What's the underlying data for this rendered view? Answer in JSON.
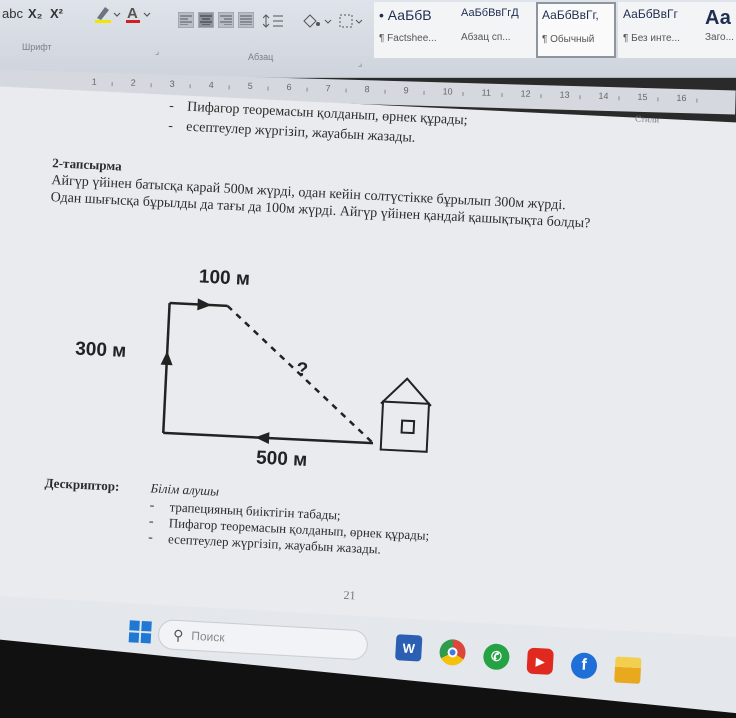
{
  "ribbon": {
    "font_group_label": "Шрифт",
    "paragraph_group_label": "Абзац",
    "styles_group_label": "Стили",
    "font_buttons": [
      "abc",
      "X₂",
      "X²"
    ],
    "styles": [
      {
        "sample": "• АаБбВ",
        "name": "¶ Factshee..."
      },
      {
        "sample": "АаБбВвГгД",
        "name": "Абзац сп..."
      },
      {
        "sample": "АаБбВвГг,",
        "name": "¶ Обычный"
      },
      {
        "sample": "АаБбВвГг",
        "name": "¶ Без инте..."
      },
      {
        "sample": "Аа",
        "name": "Заго..."
      }
    ],
    "accent_highlight": "#f2e600",
    "accent_font_color": "#d22020"
  },
  "ruler": {
    "numbers": [
      "1",
      "2",
      "3",
      "4",
      "5",
      "6",
      "7",
      "8",
      "9",
      "10",
      "11",
      "12",
      "13",
      "14",
      "15",
      "16"
    ]
  },
  "document": {
    "top_bullets": [
      "Пифагор теоремасын қолданып, өрнек құрады;",
      "есептеулер жүргізіп, жауабын жазады."
    ],
    "task_title": "2-тапсырма",
    "task_lines": [
      "Айгүр үйінен батысқа қарай 500м жүрді, одан кейін солтүстікке бұрылып 300м жүрді.",
      "Одан шығысқа бұрылды да тағы да 100м жүрді. Айгүр үйінен қандай қашықтықта болды?"
    ],
    "diagram": {
      "label_top": "100 м",
      "label_left": "300 м",
      "label_bottom": "500 м",
      "label_question": "?"
    },
    "descriptor_label": "Дескриптор:",
    "descriptor_head": "Білім алушы",
    "descriptor_bullets": [
      "трапецияның биіктігін табады;",
      "Пифагор теоремасын қолданып, өрнек құрады;",
      "есептеулер жүргізіп, жауабын жазады."
    ],
    "page_number": "21"
  },
  "taskbar": {
    "search_placeholder": "Поиск",
    "icons": [
      {
        "name": "word",
        "glyph": "W",
        "color": "#2b5fb4"
      },
      {
        "name": "chrome",
        "glyph": "",
        "color": "#d9483b"
      },
      {
        "name": "whatsapp",
        "glyph": "✆",
        "color": "#25a244"
      },
      {
        "name": "youtube",
        "glyph": "▶",
        "color": "#e02a20"
      },
      {
        "name": "facebook",
        "glyph": "f",
        "color": "#1f6fd9"
      },
      {
        "name": "file-explorer",
        "glyph": "",
        "color": "#e8b52a"
      }
    ]
  }
}
